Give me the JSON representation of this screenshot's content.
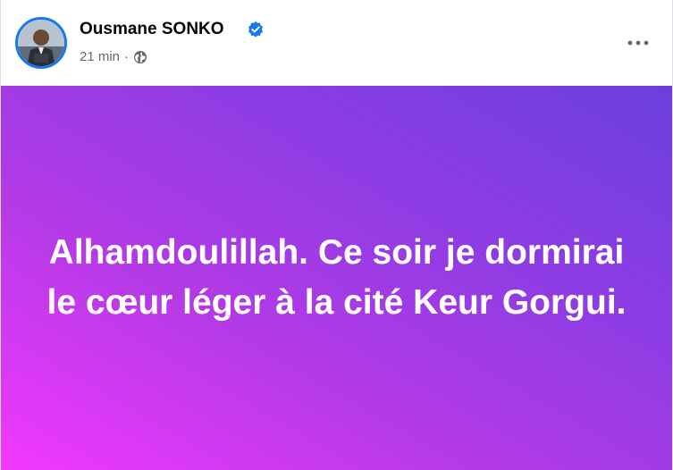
{
  "post": {
    "author": "Ousmane SONKO",
    "verified": true,
    "timestamp": "21 min",
    "separator": "·",
    "audience_icon": "globe-icon",
    "more_icon": "more-options-icon",
    "text": "Alhamdoulillah. Ce soir je dormirai le cœur léger à la cité Keur Gorgui.",
    "background_gradient": [
      "#f238ff",
      "#b53ae6",
      "#8f3ce4",
      "#6b3fdc"
    ],
    "verified_color": "#1877f2"
  }
}
